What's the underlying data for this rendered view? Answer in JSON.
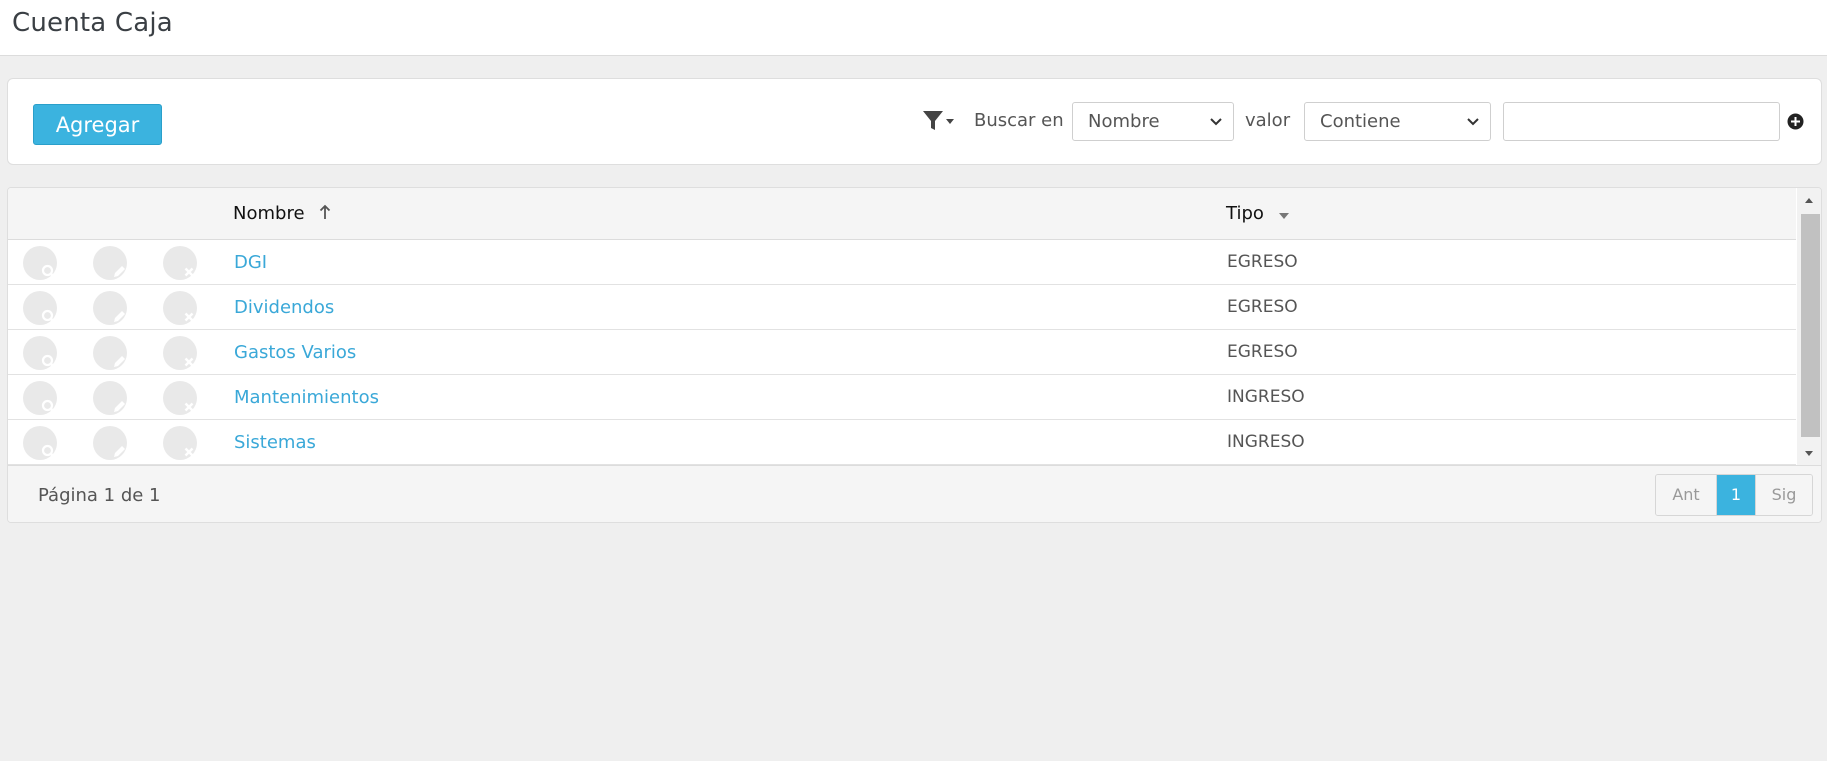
{
  "page": {
    "title": "Cuenta Caja"
  },
  "toolbar": {
    "add_label": "Agregar",
    "search_in_label": "Buscar en",
    "field_selected": "Nombre",
    "value_label": "valor",
    "operator_selected": "Contiene",
    "search_value": ""
  },
  "grid": {
    "columns": {
      "nombre": "Nombre",
      "tipo": "Tipo"
    },
    "rows": [
      {
        "nombre": "DGI",
        "tipo": "EGRESO"
      },
      {
        "nombre": "Dividendos",
        "tipo": "EGRESO"
      },
      {
        "nombre": "Gastos Varios",
        "tipo": "EGRESO"
      },
      {
        "nombre": "Mantenimientos",
        "tipo": "INGRESO"
      },
      {
        "nombre": "Sistemas",
        "tipo": "INGRESO"
      }
    ]
  },
  "footer": {
    "page_info": "Página 1 de 1",
    "prev_label": "Ant",
    "current_page": "1",
    "next_label": "Sig"
  },
  "icons": {
    "filter": "filter-icon",
    "sort_asc": "arrow-up-icon",
    "sort_menu": "caret-down-icon",
    "view": "search-icon",
    "edit": "pencil-icon",
    "delete": "close-icon",
    "add_filter": "plus-circle-icon"
  },
  "colors": {
    "accent": "#3bb3df",
    "link": "#3aa8d8"
  }
}
